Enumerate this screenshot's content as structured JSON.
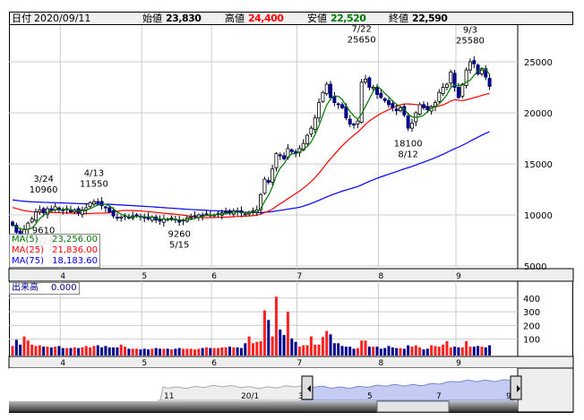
{
  "header": {
    "date_label": "日付",
    "date": "2020/09/11",
    "open_label": "始値",
    "open": "23,830",
    "high_label": "高値",
    "high": "24,400",
    "low_label": "安値",
    "low": "22,520",
    "close_label": "終値",
    "close": "22,590"
  },
  "legend": {
    "ma5_label": "MA(5)",
    "ma5": "23,256.00",
    "ma25_label": "MA(25)",
    "ma25": "21,836.00",
    "ma75_label": "MA(75)",
    "ma75": "18,183.60"
  },
  "volume_legend": {
    "label": "出来高",
    "value": "0.000"
  },
  "colors": {
    "up": "#ffffff",
    "down": "#00008b",
    "ma5": "#007700",
    "ma25": "#ff0000",
    "ma75": "#0000ff",
    "vol_up": "#ff2020",
    "vol_down": "#00008b",
    "nav_fill": "#c4ccf4",
    "nav_line": "#7a86d0"
  },
  "chart_data": {
    "type": "candlestick",
    "title": "",
    "price_axis": {
      "min": 5000,
      "max": 27000,
      "ticks": [
        5000,
        10000,
        15000,
        20000,
        25000
      ]
    },
    "volume_axis": {
      "min": 0,
      "max": 450,
      "ticks": [
        100,
        200,
        300,
        400
      ]
    },
    "month_ticks": [
      {
        "label": "4",
        "index": 13
      },
      {
        "label": "5",
        "index": 34
      },
      {
        "label": "6",
        "index": 52
      },
      {
        "label": "7",
        "index": 74
      },
      {
        "label": "8",
        "index": 95
      },
      {
        "label": "9",
        "index": 115
      }
    ],
    "close": [
      9000,
      8300,
      7900,
      8600,
      9200,
      9600,
      10300,
      10500,
      10200,
      10600,
      10400,
      10800,
      10500,
      10400,
      10600,
      10300,
      10500,
      10200,
      10500,
      10700,
      11200,
      11300,
      11200,
      10900,
      10700,
      10300,
      9900,
      9700,
      9800,
      9900,
      9700,
      9900,
      10000,
      9800,
      9700,
      9600,
      9800,
      9500,
      9400,
      9600,
      9500,
      9700,
      9500,
      9300,
      9500,
      9700,
      9800,
      9900,
      10000,
      9900,
      10100,
      10000,
      10000,
      10100,
      10200,
      10300,
      10200,
      10400,
      10300,
      10200,
      10100,
      10200,
      10400,
      10500,
      12000,
      13500,
      13200,
      14500,
      16000,
      15800,
      15500,
      16500,
      16200,
      16000,
      16500,
      17000,
      17800,
      18500,
      19500,
      21000,
      22000,
      22800,
      21500,
      21000,
      20800,
      20500,
      19500,
      18900,
      18800,
      19200,
      23000,
      23300,
      22500,
      22500,
      21800,
      21500,
      21200,
      20800,
      20500,
      20200,
      20500,
      19800,
      18500,
      19000,
      20000,
      20800,
      20500,
      20300,
      20600,
      21000,
      22000,
      22500,
      22800,
      24000,
      22500,
      21500,
      22800,
      24200,
      25000,
      24800,
      23800,
      24200,
      23500,
      22590
    ],
    "ma75_prior": 11500,
    "volume": [
      50,
      95,
      60,
      120,
      90,
      60,
      50,
      55,
      45,
      45,
      40,
      45,
      50,
      35,
      35,
      35,
      40,
      35,
      40,
      50,
      40,
      50,
      55,
      40,
      50,
      40,
      40,
      40,
      60,
      45,
      30,
      30,
      30,
      25,
      30,
      25,
      30,
      35,
      30,
      30,
      30,
      25,
      30,
      35,
      30,
      30,
      30,
      25,
      30,
      35,
      40,
      35,
      35,
      35,
      40,
      40,
      45,
      40,
      40,
      35,
      70,
      120,
      70,
      80,
      85,
      310,
      240,
      120,
      410,
      170,
      130,
      300,
      105,
      80,
      45,
      55,
      55,
      120,
      60,
      60,
      115,
      160,
      135,
      70,
      70,
      50,
      45,
      45,
      30,
      35,
      90,
      90,
      45,
      45,
      45,
      30,
      35,
      50,
      40,
      35,
      35,
      30,
      55,
      45,
      55,
      40,
      25,
      30,
      55,
      50,
      45,
      60,
      85,
      40,
      45,
      40,
      40,
      85,
      45,
      45,
      50,
      45,
      40,
      55
    ],
    "annotations": [
      {
        "date": "3/24",
        "value": "10960",
        "index": 8,
        "pos": "above",
        "price": 10960
      },
      {
        "date": "3/23",
        "value": "9610",
        "index": 8,
        "pos": "below",
        "price": 9610
      },
      {
        "date": "4/13",
        "value": "11550",
        "index": 21,
        "pos": "above",
        "price": 11550
      },
      {
        "date": "5/15",
        "value": "9260",
        "index": 43,
        "pos": "below",
        "price": 9260
      },
      {
        "date": "7/22",
        "value": "25650",
        "index": 90,
        "pos": "above",
        "price": 25650
      },
      {
        "date": "8/12",
        "value": "18100",
        "index": 102,
        "pos": "below",
        "price": 18100
      },
      {
        "date": "9/3",
        "value": "25580",
        "index": 118,
        "pos": "above",
        "price": 25580
      }
    ],
    "navigator_ticks": [
      "11",
      "20/1",
      "3",
      "5",
      "7",
      "9"
    ]
  }
}
